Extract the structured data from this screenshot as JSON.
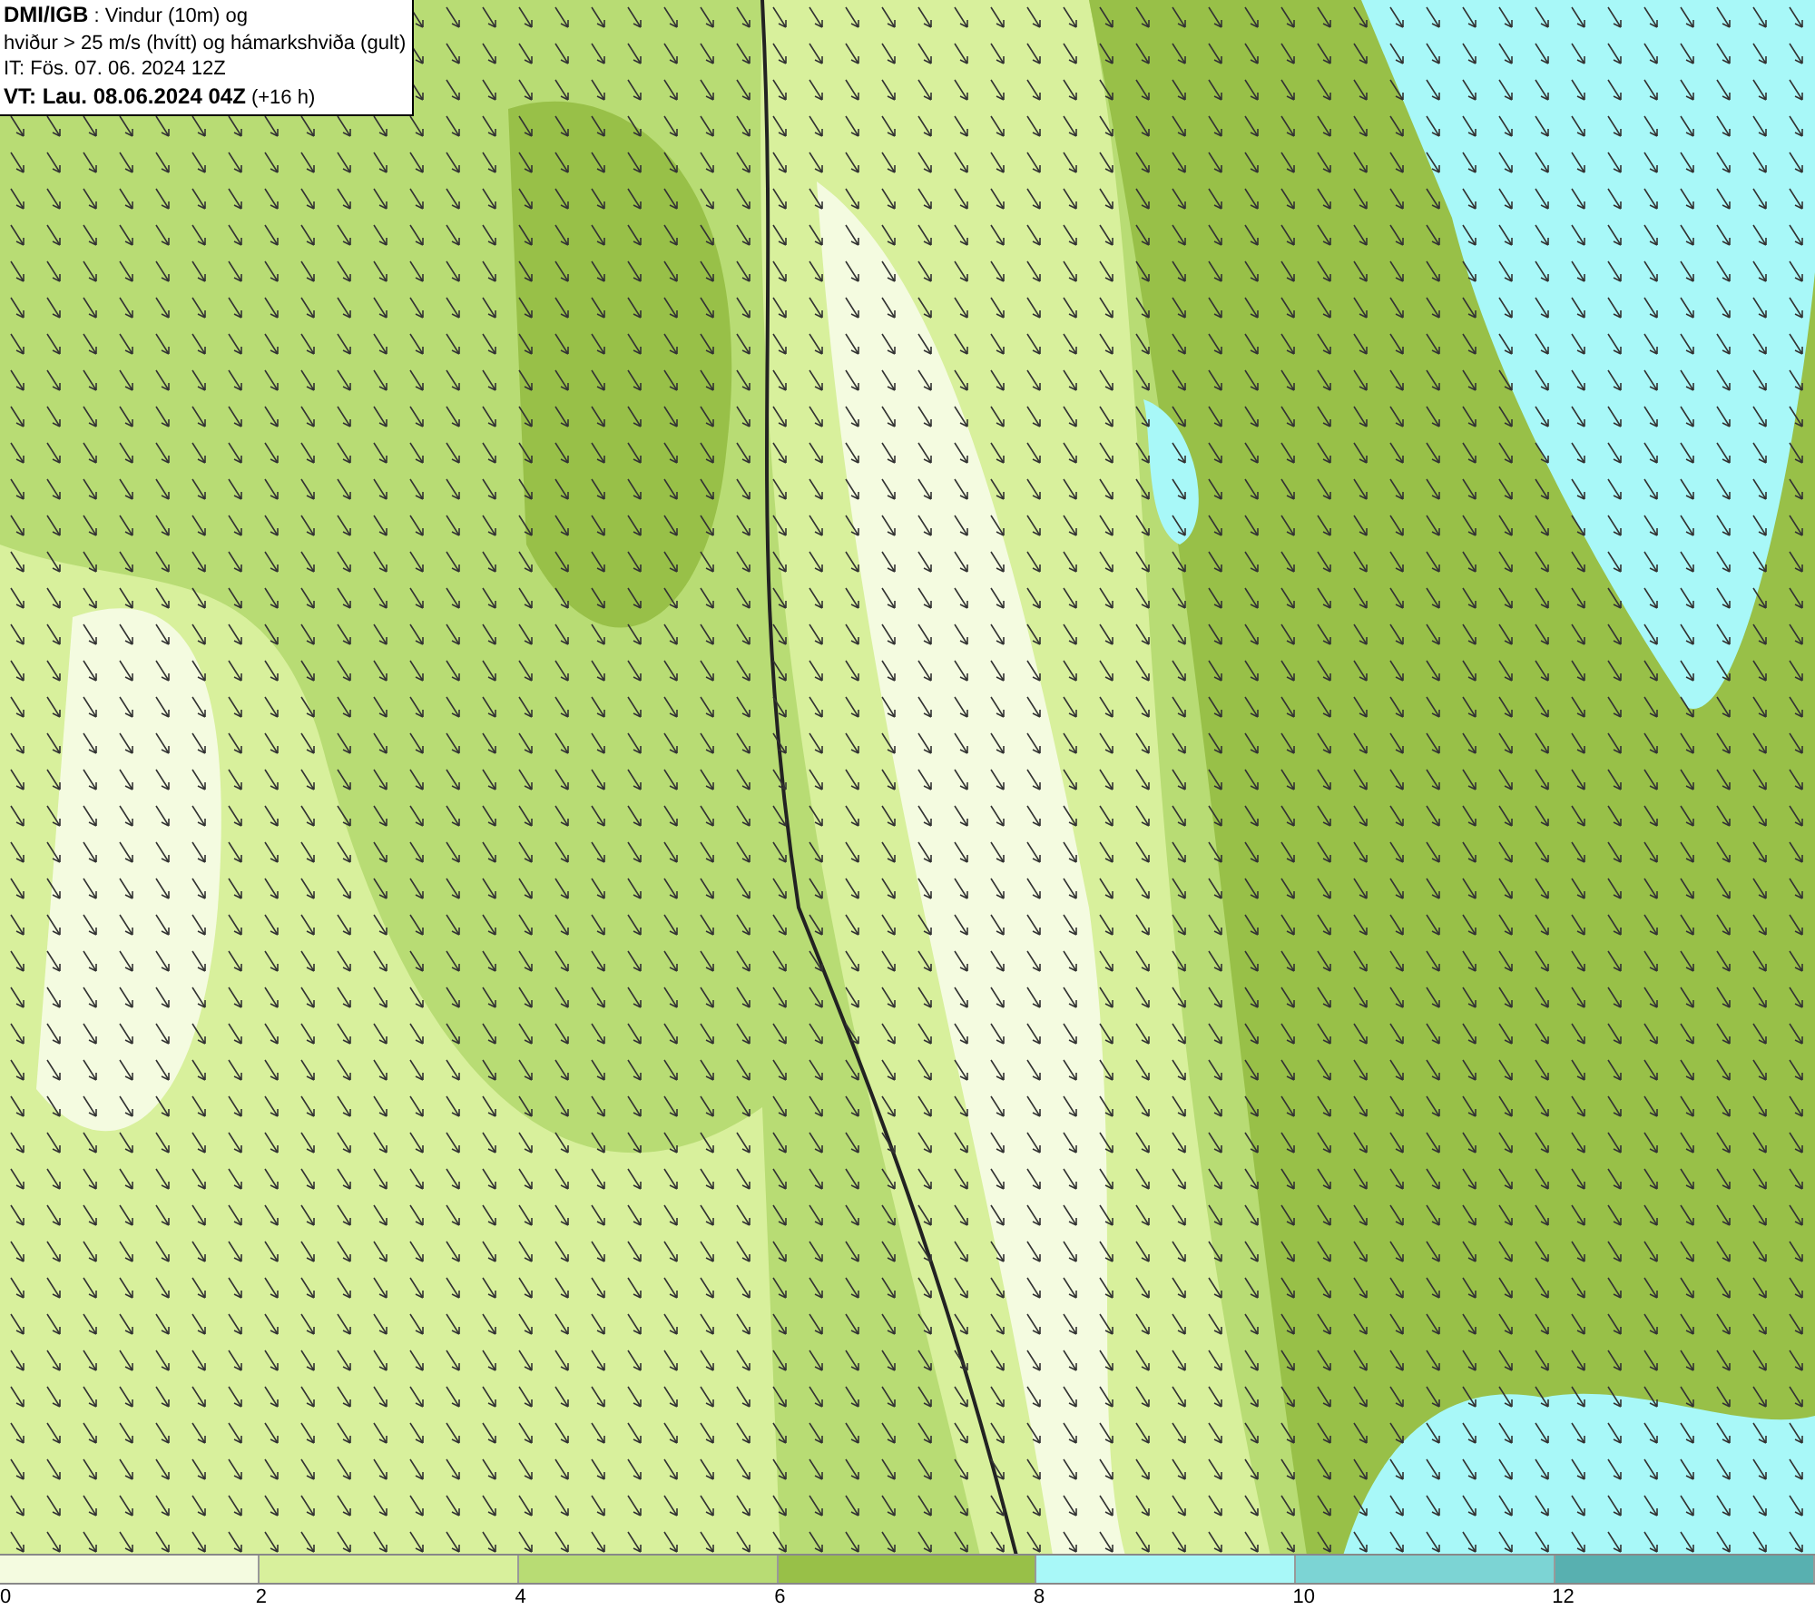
{
  "title_box": {
    "lines": [
      "**DMI/IGB** : Vindur (10m) og",
      "hviður > 25 m/s (hvítt) og hámarkshviða (gult)",
      "IT: Fös. 07. 06. 2024 12Z",
      "**VT: Lau. 08.06.2024 04Z** (+16 h)"
    ]
  },
  "legend": {
    "segments": [
      {
        "color": "#f4fbe0",
        "label": "0"
      },
      {
        "color": "#d8f09c",
        "label": "2"
      },
      {
        "color": "#b8dc74",
        "label": "4"
      },
      {
        "color": "#98c048",
        "label": "6"
      },
      {
        "color": "#a8f8f8",
        "label": "8"
      },
      {
        "color": "#7cd4d4",
        "label": "10"
      },
      {
        "color": "#58b0b0",
        "label": "12"
      }
    ]
  }
}
